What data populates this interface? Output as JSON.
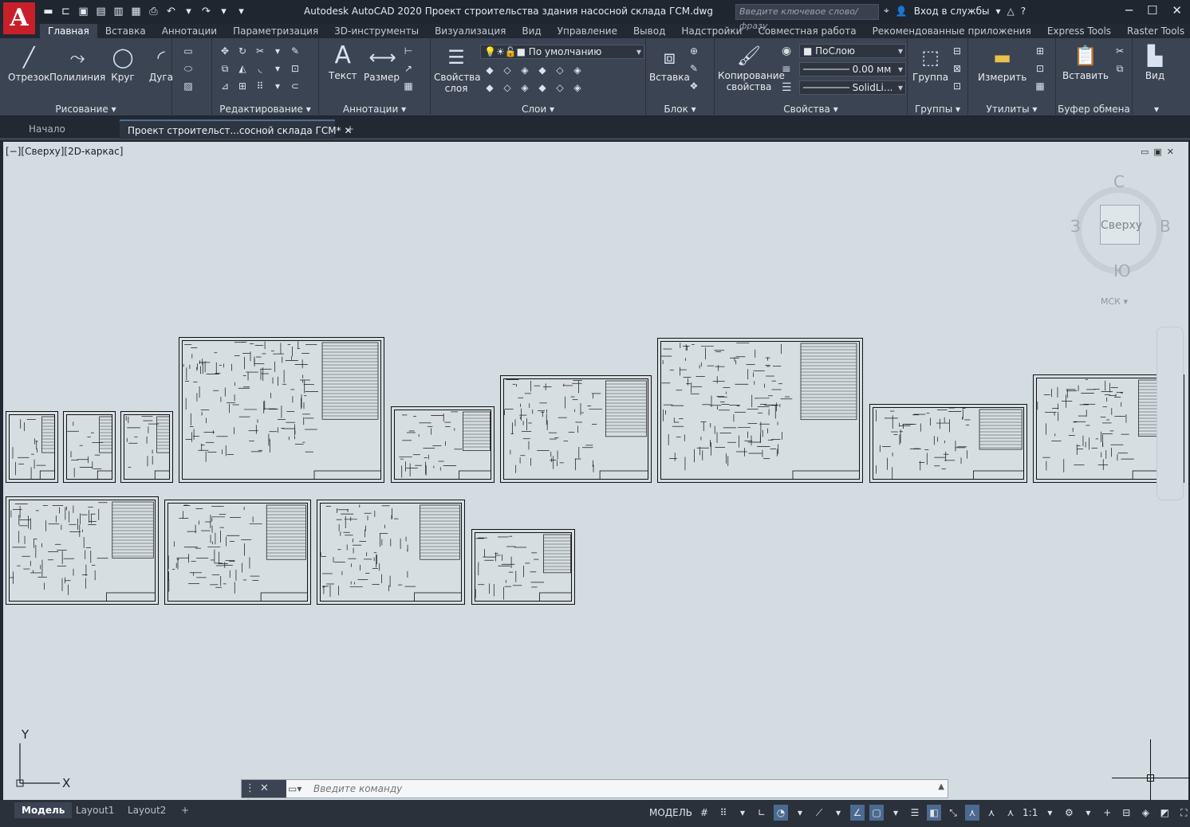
{
  "app": {
    "title": "Autodesk AutoCAD 2020   Проект строительства здания насосной склада ГСМ.dwg",
    "logo_letter": "A",
    "search_placeholder": "Введите ключевое слово/фразу",
    "signin": "Вход в службы"
  },
  "ribbon_tabs": [
    "Главная",
    "Вставка",
    "Аннотации",
    "Параметризация",
    "3D-инструменты",
    "Визуализация",
    "Вид",
    "Управление",
    "Вывод",
    "Надстройки",
    "Совместная работа",
    "Рекомендованные приложения",
    "Express Tools",
    "Raster Tools"
  ],
  "ribbon": {
    "draw": {
      "label": "Рисование",
      "line": "Отрезок",
      "polyline": "Полилиния",
      "circle": "Круг",
      "arc": "Дуга"
    },
    "modify": {
      "label": "Редактирование"
    },
    "annotation": {
      "label": "Аннотации",
      "text": "Текст",
      "dimension": "Размер"
    },
    "layers": {
      "label": "Слои",
      "properties": "Свойства слоя",
      "current_layer": "По умолчанию"
    },
    "block": {
      "label": "Блок",
      "insert": "Вставка"
    },
    "properties": {
      "label": "Свойства",
      "match": "Копирование свойства",
      "color": "ПоСлою",
      "lineweight": "0.00 мм",
      "linetype": "SolidLi..."
    },
    "groups": {
      "label": "Группы",
      "group": "Группа"
    },
    "utilities": {
      "label": "Утилиты",
      "measure": "Измерить"
    },
    "clipboard": {
      "label": "Буфер обмена",
      "paste": "Вставить"
    },
    "view": {
      "label": "Вид"
    }
  },
  "file_tabs": {
    "start": "Начало",
    "doc": "Проект строительст...сосной склада ГСМ*",
    "add": "+"
  },
  "viewport": {
    "label": "[−][Сверху][2D-каркас]",
    "viewcube": {
      "face": "Сверху",
      "n": "С",
      "s": "Ю",
      "w": "З",
      "e": "В",
      "ucs": "МСК"
    },
    "ucs_x": "X",
    "ucs_y": "Y"
  },
  "command": {
    "placeholder": "Введите команду"
  },
  "layout_tabs": [
    "Модель",
    "Layout1",
    "Layout2"
  ],
  "status": {
    "model": "МОДЕЛЬ",
    "scale": "1:1"
  }
}
